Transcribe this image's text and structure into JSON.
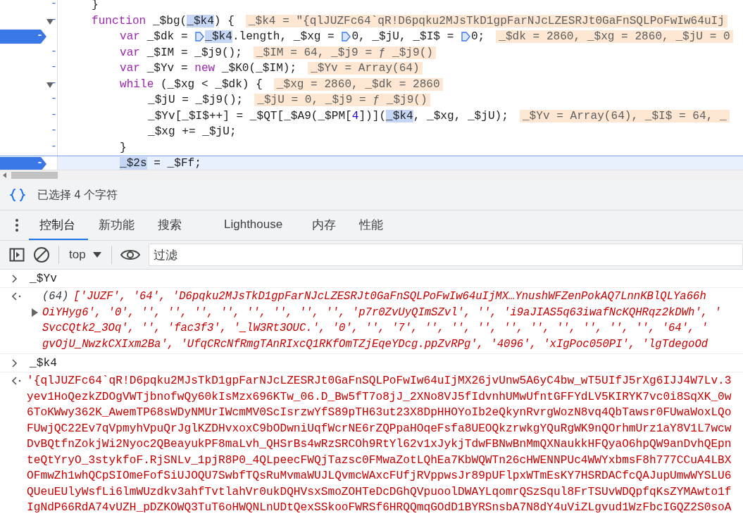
{
  "editor": {
    "lines": [
      {
        "marker": "-",
        "breakpoint": false,
        "foldable": false,
        "current": false,
        "segments": [
          {
            "kind": "plain",
            "text": "}"
          }
        ]
      },
      {
        "marker": "-",
        "breakpoint": false,
        "foldable": true,
        "current": false,
        "segments": [
          {
            "kind": "keyword",
            "text": "function"
          },
          {
            "kind": "plain",
            "text": " _$bg("
          },
          {
            "kind": "selected",
            "text": "_$k4"
          },
          {
            "kind": "plain",
            "text": ") {"
          }
        ],
        "inline_value": "_$k4 = \"{qlJUZFc64`qR!D6pqku2MJsTkD1gpFarNJcLZESRJt0GaFnSQLPoFwIw64uIj",
        "children": [
          {
            "marker": "-",
            "breakpoint": true,
            "foldable": false,
            "current": false,
            "segments": [
              {
                "kind": "keyword",
                "text": "var"
              },
              {
                "kind": "plain",
                "text": " _$dk = "
              },
              {
                "kind": "marker"
              },
              {
                "kind": "selected",
                "text": "_$k4"
              },
              {
                "kind": "plain",
                "text": ".length, _$xg = "
              },
              {
                "kind": "marker"
              },
              {
                "kind": "plain",
                "text": "0, _$jU, _$I$ = "
              },
              {
                "kind": "marker"
              },
              {
                "kind": "plain",
                "text": "0;"
              }
            ],
            "inline_value": "_$dk = 2860, _$xg = 2860, _$jU = 0"
          },
          {
            "marker": "-",
            "breakpoint": false,
            "foldable": false,
            "current": false,
            "segments": [
              {
                "kind": "keyword",
                "text": "var"
              },
              {
                "kind": "plain",
                "text": " _$IM = _$j9();"
              }
            ],
            "inline_value": "_$IM = 64, _$j9 = ƒ _$j9()"
          },
          {
            "marker": "-",
            "breakpoint": false,
            "foldable": false,
            "current": false,
            "segments": [
              {
                "kind": "keyword",
                "text": "var"
              },
              {
                "kind": "plain",
                "text": " _$Yv = "
              },
              {
                "kind": "keyword",
                "text": "new"
              },
              {
                "kind": "plain",
                "text": " _$K0(_$IM);"
              }
            ],
            "inline_value": "_$Yv = Array(64)"
          },
          {
            "marker": "-",
            "breakpoint": false,
            "foldable": true,
            "current": false,
            "segments": [
              {
                "kind": "keyword",
                "text": "while"
              },
              {
                "kind": "plain",
                "text": " (_$xg < _$dk) {"
              }
            ],
            "inline_value": "_$xg = 2860, _$dk = 2860",
            "children": [
              {
                "marker": "-",
                "breakpoint": false,
                "foldable": false,
                "current": false,
                "segments": [
                  {
                    "kind": "plain",
                    "text": "_$jU = _$j9();"
                  }
                ],
                "inline_value": "_$jU = 0, _$j9 = ƒ _$j9()"
              },
              {
                "marker": "-",
                "breakpoint": false,
                "foldable": false,
                "current": false,
                "segments": [
                  {
                    "kind": "plain",
                    "text": "_$Yv[_$I$++] = _$QT[_$A9(_$PM["
                  },
                  {
                    "kind": "number",
                    "text": "4"
                  },
                  {
                    "kind": "plain",
                    "text": "])]("
                  },
                  {
                    "kind": "selected",
                    "text": "_$k4"
                  },
                  {
                    "kind": "plain",
                    "text": ", _$xg, _$jU);"
                  }
                ],
                "inline_value": "_$Yv = Array(64), _$I$ = 64, _"
              },
              {
                "marker": "-",
                "breakpoint": false,
                "foldable": false,
                "current": false,
                "segments": [
                  {
                    "kind": "plain",
                    "text": "_$xg += _$jU;"
                  }
                ]
              }
            ]
          },
          {
            "marker": "-",
            "breakpoint": false,
            "foldable": false,
            "current": false,
            "segments": [
              {
                "kind": "plain",
                "text": "}"
              }
            ]
          },
          {
            "marker": "-",
            "breakpoint": true,
            "foldable": false,
            "current": true,
            "segments": [
              {
                "kind": "selected",
                "text": "_$2s"
              },
              {
                "kind": "plain",
                "text": " = _$Ff;"
              }
            ]
          }
        ]
      }
    ]
  },
  "selection_status": {
    "text": "已选择 4 个字符"
  },
  "tabs": [
    {
      "label": "控制台",
      "selected": true
    },
    {
      "label": "新功能",
      "selected": false
    },
    {
      "label": "搜索",
      "selected": false
    },
    {
      "label": "Lighthouse",
      "selected": false
    },
    {
      "label": "内存",
      "selected": false
    },
    {
      "label": "性能",
      "selected": false
    }
  ],
  "toolbar": {
    "context": "top",
    "filter": {
      "placeholder": "过滤"
    }
  },
  "console": [
    {
      "kind": "input",
      "text": "_$Yv"
    },
    {
      "kind": "array",
      "count": "(64)",
      "expanded": false,
      "lines": [
        "['JUZF', '64', 'D6pqku2MJsTkD1gpFarNJcLZESRJt0GaFnSQLPoFwIw64uIjMX…YnushWFZenPokAQ7LnnKBlQLYa66h",
        "OiYHyg6', '0', '', '', '', '', '', '', '', '', 'p7r0ZvUyQImSZvl', '', 'i9aJIAS5q63iwafNcKQHRqz2kDWh', '",
        "SvcCQtk2_3Oq', '', 'fac3f3', '_lW3Rt3OUC.', '0', '', '7', '', '', '', '', '', '', '', '', '', '64', '",
        "gvOjU_NwzkCXIxm2Ba', 'UfqCRcNfRmgTAnRIxcQ1RKfOmTZjEqeYDcg.ppZvRPg', '4096', 'xIgPoc050PI', 'lgTdegoOd"
      ]
    },
    {
      "kind": "input",
      "text": "_$k4"
    },
    {
      "kind": "string",
      "lines": [
        "'{qlJUZFc64`qR!D6pqku2MJsTkD1gpFarNJcLZESRJt0GaFnSQLPoFwIw64uIjMX26jvUnw5A6yC4bw_wT5UIfJ5rXg6IJJ4W7Lv.3",
        "yev1HoQezkZDOgVWTjbnofwQy60kIsMzx696KTw_06.D_Bw5fT7o8jJ_2XNo8VJ5fIdvnhUMwUfntGFFYdLV5KIRYK7vc0i8SqXK_0w",
        "6ToKWwy362K_AwemTP68sWDyNMUrIWcmMV0ScIsrzwYfS89pTH63ut23X8DpHHOYoIb2eQkynRvrgWozN8vq4QbTawsr0FUwaWoxLQo",
        "FUwjQC22Ev7qVpmyhVpuQrJglKZDHvxoxC9bODwniUqfWcrNE6rZQPpaHOqeFsfa8UEOQkzrwkgYQuRgWK9nQOrhmUrz1aY8V1L7wcw",
        "DvBQtfnZokjWi2Nyoc2QBeayukPF8maLvh_QHSrBs4wRzSRCOh9RtYl62v1xJykjTdwFBNwBnMmQXNaukkHFQyaO6hpQW9anDvhQEpn",
        "teQtYryO_3stykfoF.RjSNLv_1pjR8P0_4QLpeecFWQjTazsc0FMwaZotLQhEa7KbWQWTn26cHWENNPUc4WWYxbmsF8h777CCuA4LBX",
        "OFmwZh1whQCpSIOmeFofSiUJOQU7SwbfTQsRuMvmaWUJLQvmcWAxcFUfjRVppwsJr89pUFlpxWTmEsKY7HSRDACfcQAJupUmwWYSLU6",
        "QUeuEUlyWsfLi6lmWUzdkv3ahfTvtlahVr0ukDQHVsxSmoZOHTeDcDGhQVpuoolDWAYLqomrQSzSqul8FrTSUvWDQpfqKsZYMAwto1f",
        "IgNdP66RdA74vUZH_pDZKOWQ3TuT6oHWQNLnUDtQexSSkooFWRSf6HRQQmqGOdD1BYRSnsbA7N8dY4uViZLgvud1WzFbcIGQZ2S0soA"
      ]
    }
  ]
}
